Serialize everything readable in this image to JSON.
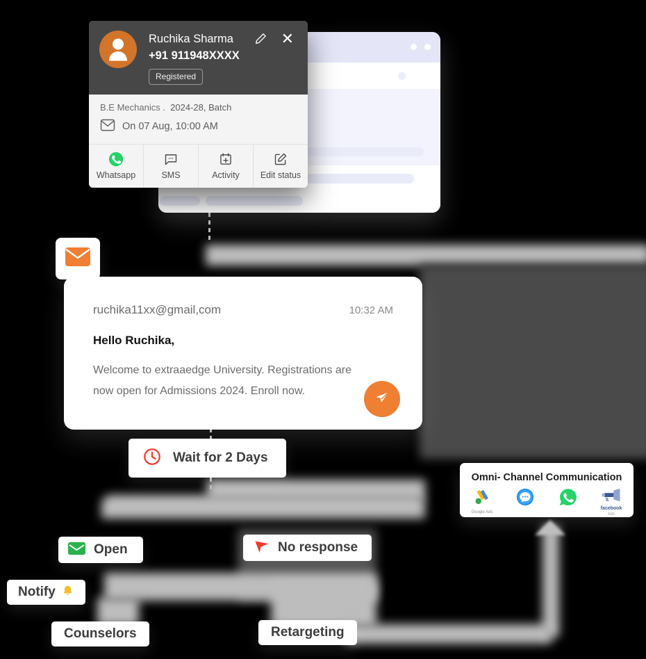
{
  "contact_card": {
    "name": "Ruchika Sharma",
    "phone": "+91 911948XXXX",
    "status_badge": "Registered",
    "course": "B.E Mechanics .",
    "batch": "2024-28, Batch",
    "appointment": "On 07 Aug, 10:00 AM",
    "edit_icon": "pencil-icon",
    "close_icon": "✕",
    "actions": [
      {
        "label": "Whatsapp",
        "icon": "whatsapp-icon"
      },
      {
        "label": "SMS",
        "icon": "sms-icon"
      },
      {
        "label": "Activity",
        "icon": "calendar-plus-icon"
      },
      {
        "label": "Edit status",
        "icon": "edit-square-icon"
      }
    ]
  },
  "mail_badge": {
    "icon": "envelope-icon",
    "color": "#ef7f32"
  },
  "email_card": {
    "from": "ruchika11xx@gmail,com",
    "time": "10:32 AM",
    "greeting": "Hello Ruchika,",
    "body": "Welcome to extraaedge University. Registrations are now open for Admissions  2024. Enroll now.",
    "send_icon": "paper-plane-icon",
    "send_color": "#ef7f32"
  },
  "flow": {
    "wait": {
      "label": "Wait for 2 Days",
      "icon": "clock-icon",
      "icon_color": "#f3392b"
    },
    "open": {
      "label": "Open",
      "icon": "envelope-open-icon",
      "icon_color": "#2bb24c"
    },
    "no_response": {
      "label": "No response",
      "icon": "red-chevron-icon",
      "icon_color": "#f3392b"
    },
    "notify": {
      "label": "Notify",
      "icon": "bell-emoji",
      "emoji": "🔔"
    },
    "counselors": {
      "label": "Counselors"
    },
    "retargeting": {
      "label": "Retargeting"
    }
  },
  "omni_panel": {
    "title": "Omni- Channel Communication",
    "channels": [
      {
        "name": "google-ads-icon",
        "caption": "Google Ads"
      },
      {
        "name": "chat-bubble-icon",
        "caption": ""
      },
      {
        "name": "whatsapp-icon",
        "caption": ""
      },
      {
        "name": "facebook-ads-icon",
        "caption_brand": "facebook",
        "caption": "Ads"
      }
    ]
  },
  "browser_window": {
    "title_dots": 2,
    "skeleton_bars": 4
  },
  "colors": {
    "accent_orange": "#ef7f32",
    "avatar_orange": "#d2742a",
    "header_dark": "#474747",
    "red": "#f3392b",
    "green": "#2bb24c",
    "skeleton": "#e9ebf9",
    "background": "#000000"
  }
}
